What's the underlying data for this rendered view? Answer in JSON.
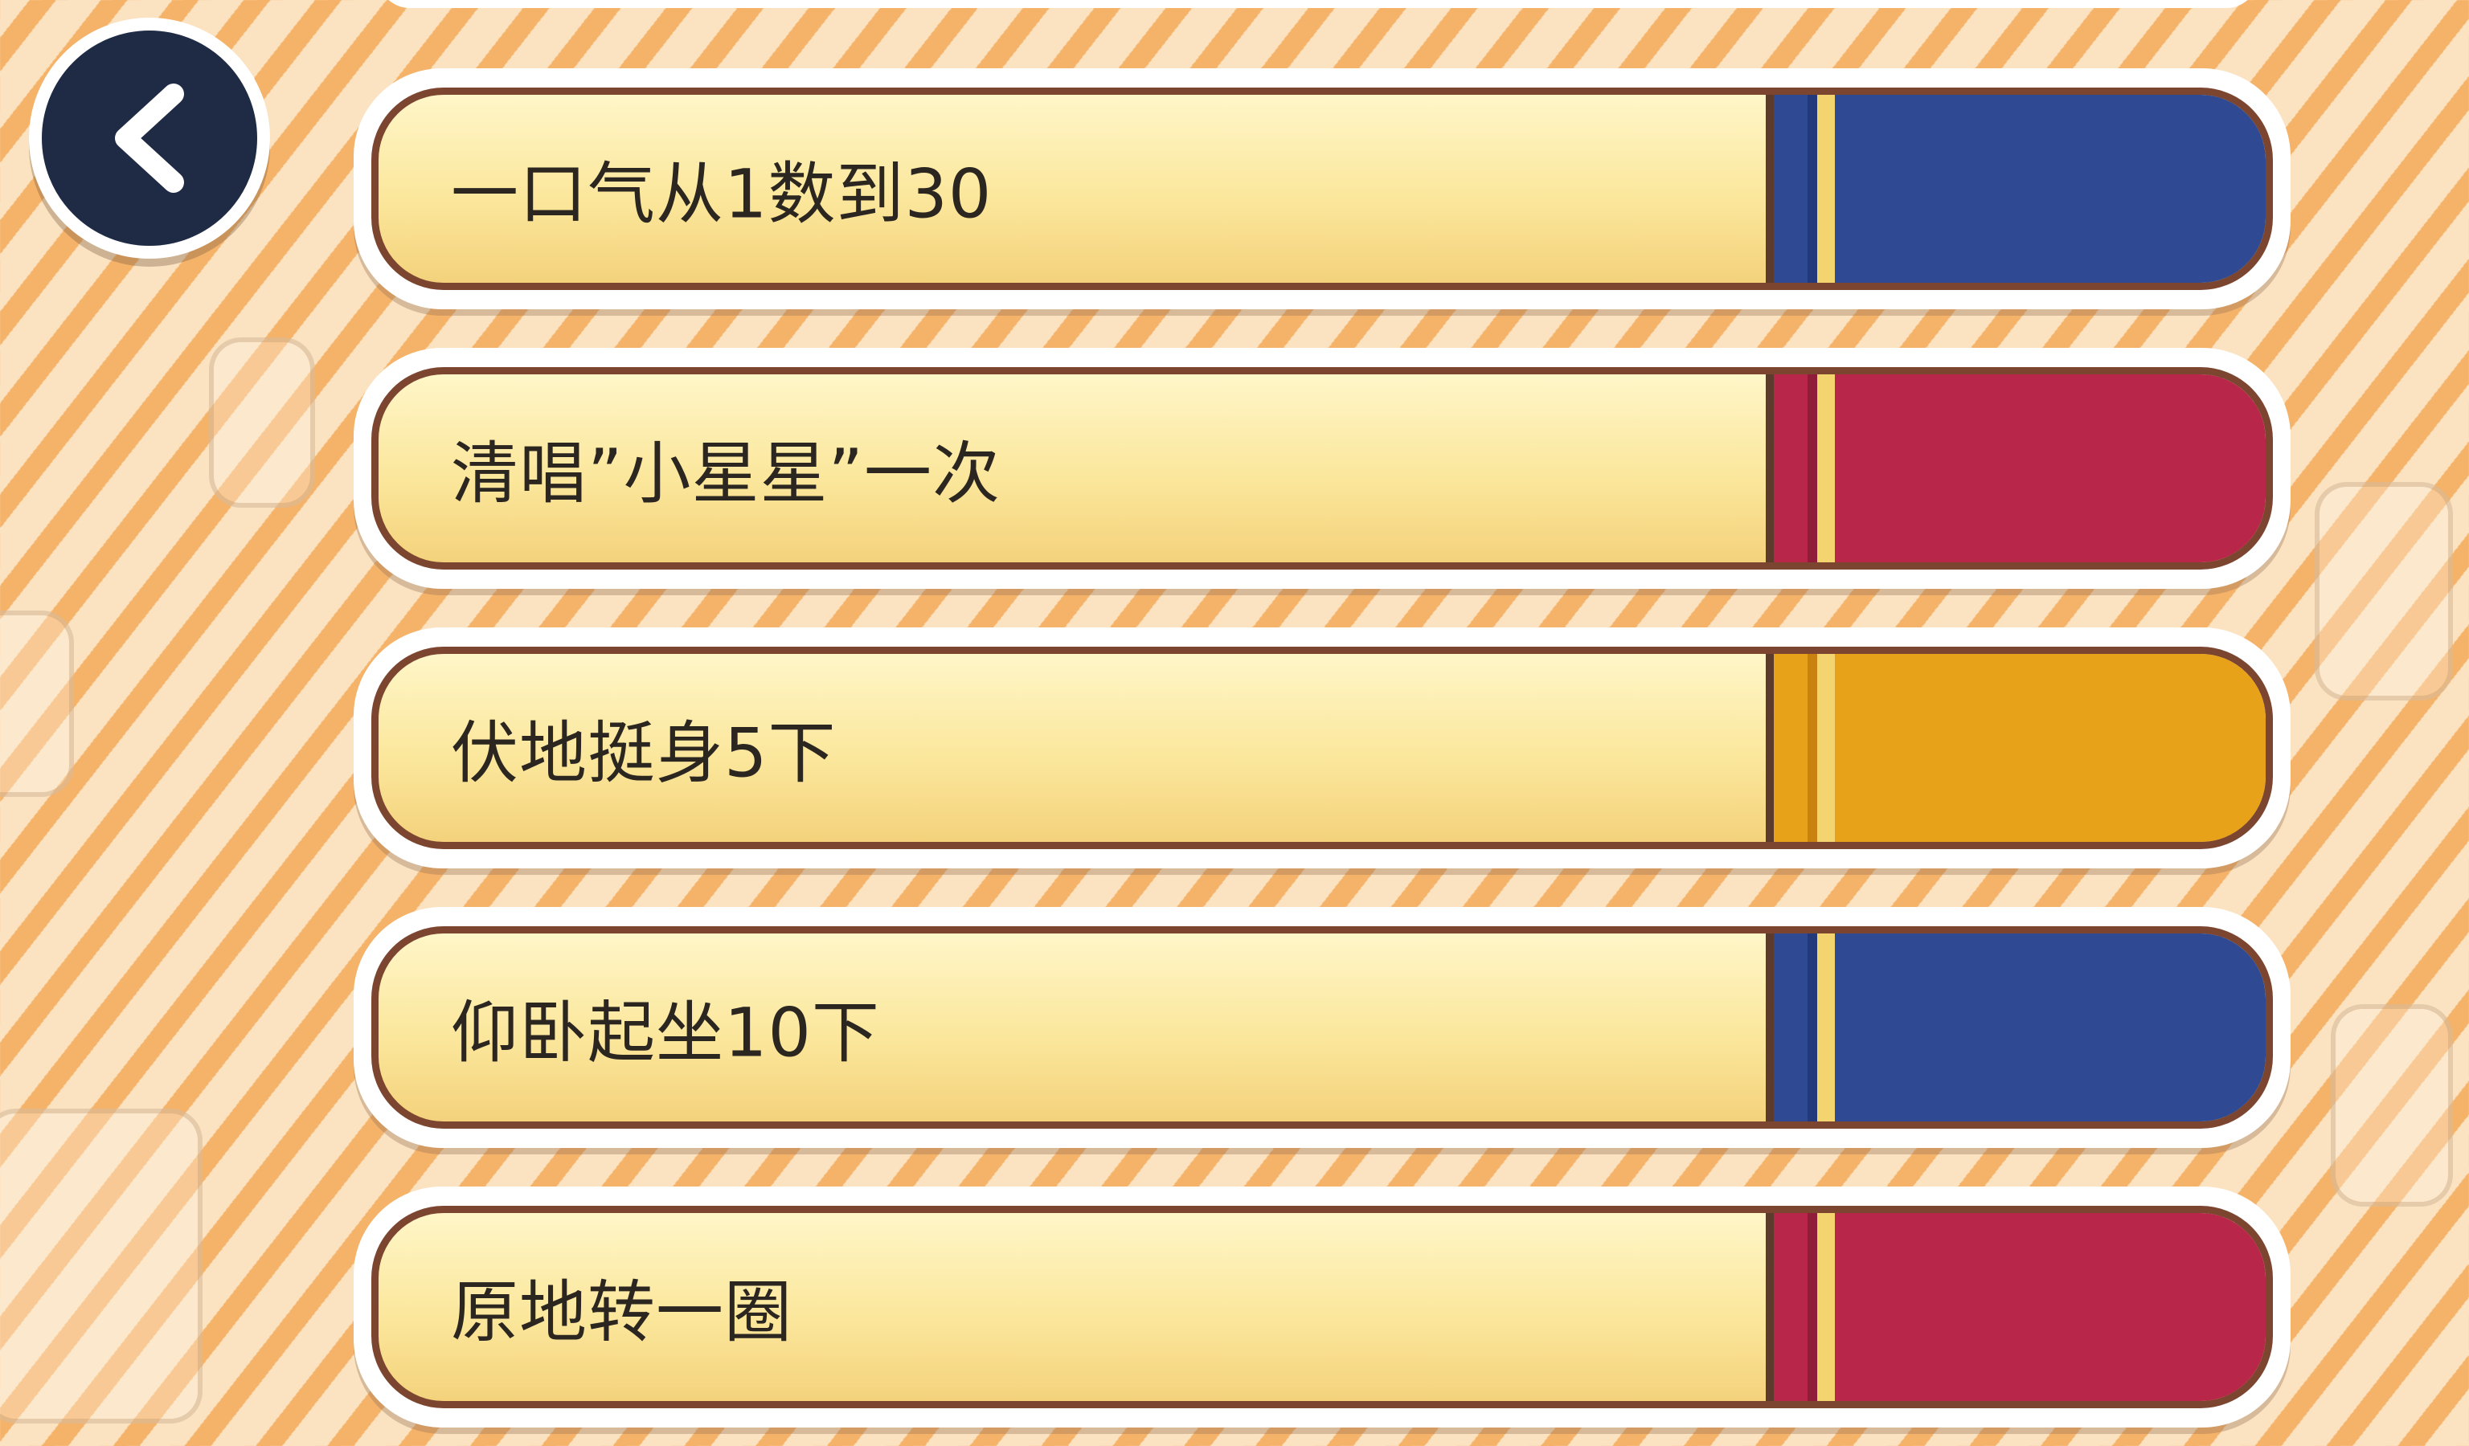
{
  "navigation": {
    "back_icon": "chevron-left-icon",
    "back_button_color": "#1f2b44"
  },
  "tasks": [
    {
      "label": "一口气从1数到30",
      "color": "#2f4a93"
    },
    {
      "label": "清唱”小星星”一次",
      "color": "#b8264a"
    },
    {
      "label": "伏地挺身5下",
      "color": "#e8a21a"
    },
    {
      "label": "仰卧起坐10下",
      "color": "#2f4a93"
    },
    {
      "label": "原地转一圈",
      "color": "#b8264a"
    }
  ],
  "theme": {
    "background": "#fbe3c2",
    "background_stripe": "#f5b36a",
    "card_fill": "#fbe79c",
    "card_border": "#7c4530"
  }
}
